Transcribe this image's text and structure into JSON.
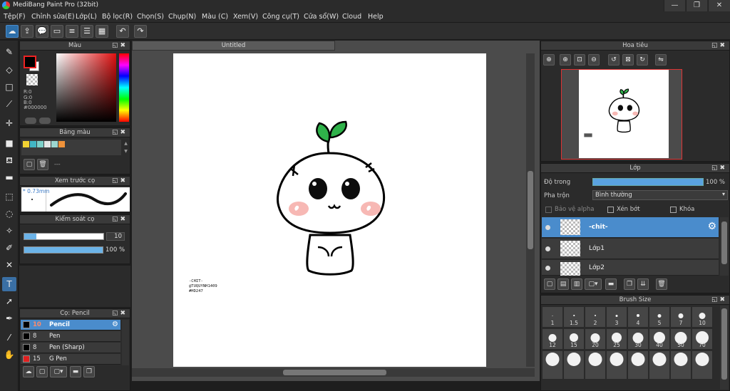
{
  "window": {
    "title": "MediBang Paint Pro (32bit)",
    "min": "—",
    "max": "❐",
    "close": "✕"
  },
  "menu": [
    "Tệp(F)",
    "Chỉnh sửa(E)",
    "Lớp(L)",
    "Bộ lọc(R)",
    "Chọn(S)",
    "Chụp(N)",
    "Màu (C)",
    "Xem(V)",
    "Công cụ(T)",
    "Cửa sổ(W)",
    "Cloud",
    "Help"
  ],
  "color_panel": {
    "title": "Màu",
    "r": "R:0",
    "g": "G:0",
    "b": "B:0",
    "hex": "#000000",
    "primary_color": "#000000",
    "secondary_color": "#ffffff"
  },
  "palette_panel": {
    "title": "Bảng màu",
    "colors": [
      "#f2d232",
      "#42b6c4",
      "#7dd0c9",
      "#e6e6e6",
      "#9cd6d0",
      "#f0923a"
    ],
    "dash": "---"
  },
  "preview_panel": {
    "title": "Xem trước cọ",
    "size_text": "0.73mm"
  },
  "control_panel": {
    "title": "Kiểm soát cọ",
    "size_value": "10",
    "size_fraction": 0.15,
    "opacity_value": "100",
    "opacity_unit": "%",
    "opacity_fraction": 1.0
  },
  "brush_panel": {
    "title": "Cọ: Pencil",
    "items": [
      {
        "size": "10",
        "name": "Pencil",
        "color": "#000000"
      },
      {
        "size": "8",
        "name": "Pen",
        "color": "#000000"
      },
      {
        "size": "8",
        "name": "Pen (Sharp)",
        "color": "#000000"
      },
      {
        "size": "15",
        "name": "G Pen",
        "color": "#e02020"
      }
    ]
  },
  "canvas": {
    "tab_title": "Untitled",
    "signature_lines": [
      "-CHIT-",
      "@TUQUYNH1409",
      "#HD247"
    ]
  },
  "navigator": {
    "title": "Hoa tiêu"
  },
  "layer_panel": {
    "title": "Lớp",
    "opacity_label": "Độ trong",
    "opacity_value": "100 %",
    "opacity_fraction": 1.0,
    "blend_label": "Pha trộn",
    "blend_value": "Bình thường",
    "protect_alpha": "Bảo vệ alpha",
    "clipping": "Xén bớt",
    "lock": "Khóa",
    "layers": [
      {
        "name": "-chit-"
      },
      {
        "name": "Lớp1"
      },
      {
        "name": "Lớp2"
      }
    ]
  },
  "brush_size_panel": {
    "title": "Brush Size",
    "sizes": [
      "1",
      "1.5",
      "2",
      "3",
      "4",
      "5",
      "7",
      "10",
      "12",
      "15",
      "20",
      "25",
      "30",
      "40",
      "50",
      "70"
    ]
  },
  "accent_color": "#4a8ccc"
}
